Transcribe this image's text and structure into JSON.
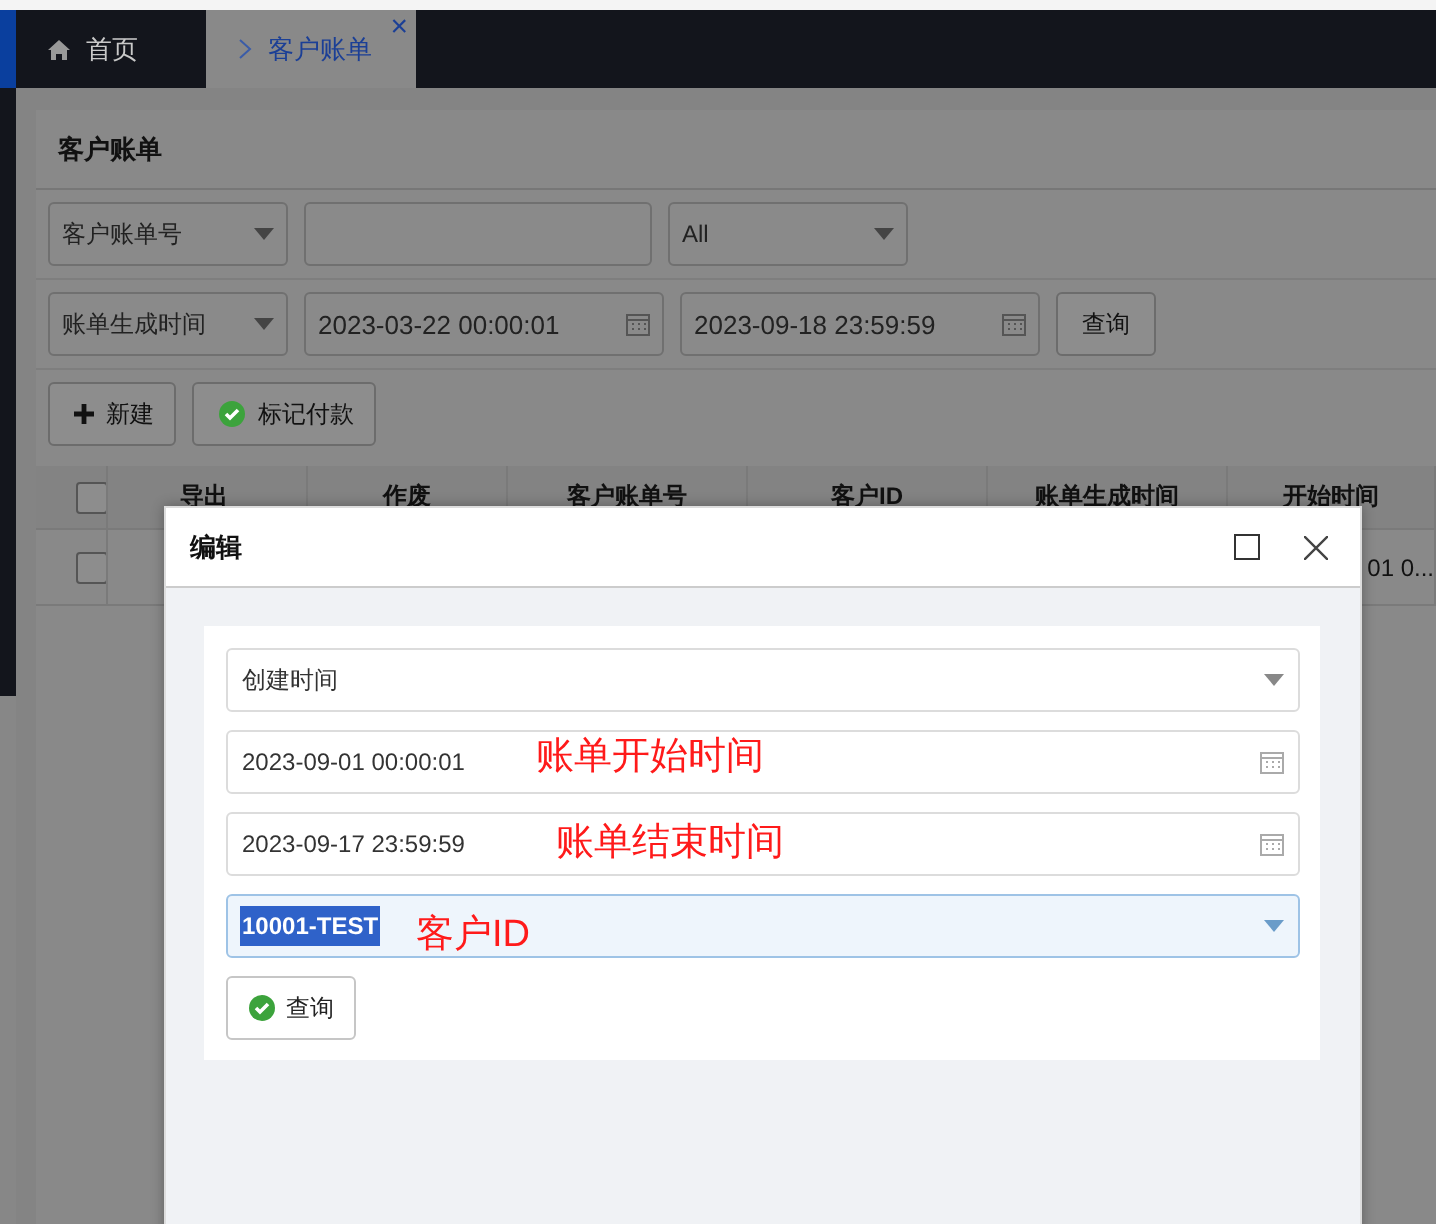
{
  "tabs": [
    {
      "label": "首页",
      "kind": "home",
      "selected": false
    },
    {
      "label": "客户账单",
      "kind": "page",
      "selected": true,
      "close": "×"
    }
  ],
  "panel": {
    "title": "客户账单",
    "filters": [
      {
        "kind": "select",
        "value": "客户账单号"
      },
      {
        "kind": "input"
      },
      {
        "kind": "select",
        "value": "All"
      }
    ],
    "date_filters": [
      {
        "kind": "select",
        "value": "账单生成时间"
      },
      {
        "kind": "date",
        "value": "2023-03-22 00:00:01"
      },
      {
        "kind": "date",
        "value": "2023-09-18 23:59:59"
      },
      {
        "kind": "button",
        "value": "查询"
      }
    ],
    "toolbar": [
      {
        "label": "新建",
        "kind": "add"
      },
      {
        "label": "标记付款",
        "kind": "confirm"
      }
    ],
    "table": {
      "columns": [
        "导出",
        "作废",
        "客户账单号",
        "客户ID",
        "账单生成时间",
        "开始时间"
      ],
      "rows": [
        {
          "checked": false,
          "column_6": "01 0..."
        }
      ],
      "header_checked": false
    }
  },
  "dialog": {
    "title": "编辑",
    "fields": [
      {
        "kind": "select",
        "value": "创建时间",
        "focused": false
      },
      {
        "kind": "date",
        "value": "2023-09-01 00:00:01",
        "focused": false
      },
      {
        "kind": "date",
        "value": "2023-09-17 23:59:59",
        "focused": false
      },
      {
        "kind": "select",
        "value": "10001-TEST",
        "focused": true
      }
    ],
    "button": "查询",
    "annotations": [
      "账单开始时间",
      "账单结束时间",
      "客户ID"
    ]
  }
}
